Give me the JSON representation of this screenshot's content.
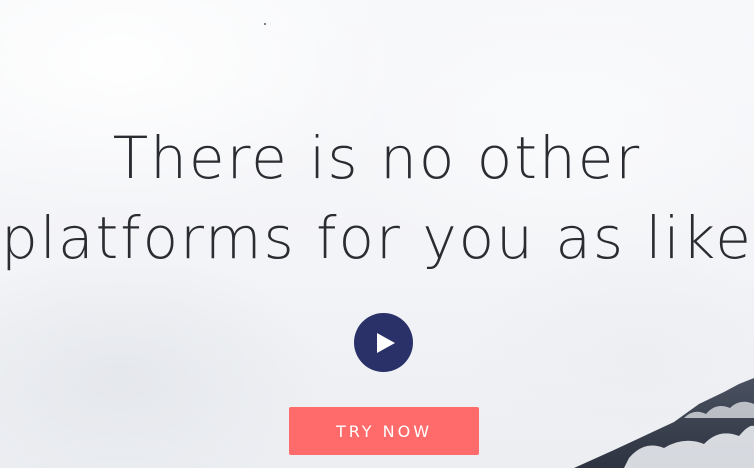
{
  "hero": {
    "headline_line1": "There is no other",
    "headline_line2": "platforms for you as like",
    "cta_label": "TRY NOW",
    "play_icon": "play-icon"
  },
  "colors": {
    "play_button": "#2a3168",
    "cta_button": "#ff6b6b",
    "headline_text": "#2a2c31"
  }
}
